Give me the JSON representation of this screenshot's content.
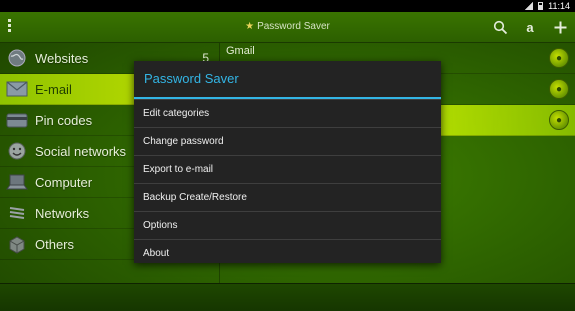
{
  "status_bar": {
    "time": "11:14"
  },
  "action_bar": {
    "title": "Password Saver",
    "overflow_icon": "overflow-menu-icon",
    "search_icon": "search-icon",
    "sort_label": "a",
    "add_icon": "add-icon"
  },
  "sidebar": {
    "items": [
      {
        "label": "Websites",
        "count": "5",
        "icon": "globe-icon"
      },
      {
        "label": "E-mail",
        "count": "",
        "icon": "envelope-icon"
      },
      {
        "label": "Pin codes",
        "count": "",
        "icon": "card-icon"
      },
      {
        "label": "Social networks",
        "count": "",
        "icon": "smiley-icon"
      },
      {
        "label": "Computer",
        "count": "",
        "icon": "laptop-icon"
      },
      {
        "label": "Networks",
        "count": "",
        "icon": "wifi-icon"
      },
      {
        "label": "Others",
        "count": "",
        "icon": "box-icon"
      }
    ]
  },
  "entries": [
    {
      "name": "Gmail"
    },
    {
      "name": ""
    },
    {
      "name": ""
    }
  ],
  "dialog": {
    "title": "Password Saver",
    "items": [
      "Edit categories",
      "Change password",
      "Export to e-mail",
      "Backup Create/Restore",
      "Options",
      "About"
    ]
  },
  "colors": {
    "accent": "#33b5e5",
    "background": "#2e6400",
    "selected": "#b4d800"
  }
}
